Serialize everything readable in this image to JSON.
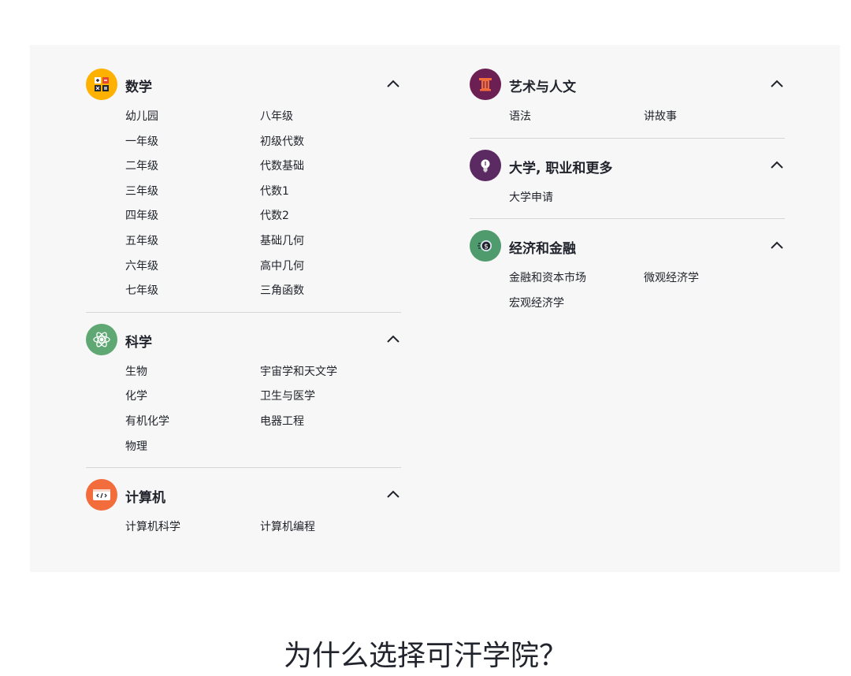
{
  "left_column": [
    {
      "title": "数学",
      "icon": "calculator-icon",
      "color": "#ffb100",
      "links": [
        "幼儿园",
        "八年级",
        "一年级",
        "初级代数",
        "二年级",
        "代数基础",
        "三年级",
        "代数1",
        "四年级",
        "代数2",
        "五年级",
        "基础几何",
        "六年级",
        "高中几何",
        "七年级",
        "三角函数"
      ]
    },
    {
      "title": "科学",
      "icon": "atom-icon",
      "color": "#5fa873",
      "links": [
        "生物",
        "宇宙学和天文学",
        "化学",
        "卫生与医学",
        "有机化学",
        "电器工程",
        "物理"
      ]
    },
    {
      "title": "计算机",
      "icon": "code-icon",
      "color": "#f26c3c",
      "links": [
        "计算机科学",
        "计算机编程"
      ]
    }
  ],
  "right_column": [
    {
      "title": "艺术与人文",
      "icon": "column-icon",
      "color": "#6b1f53",
      "links": [
        "语法",
        "讲故事"
      ]
    },
    {
      "title": "大学, 职业和更多",
      "icon": "lightbulb-icon",
      "color": "#5c2a63",
      "links": [
        "大学申请"
      ]
    },
    {
      "title": "经济和金融",
      "icon": "coin-icon",
      "color": "#4f9b6e",
      "links": [
        "金融和资本市场",
        "微观经济学",
        "宏观经济学"
      ]
    }
  ],
  "why_heading": "为什么选择可汗学院？"
}
